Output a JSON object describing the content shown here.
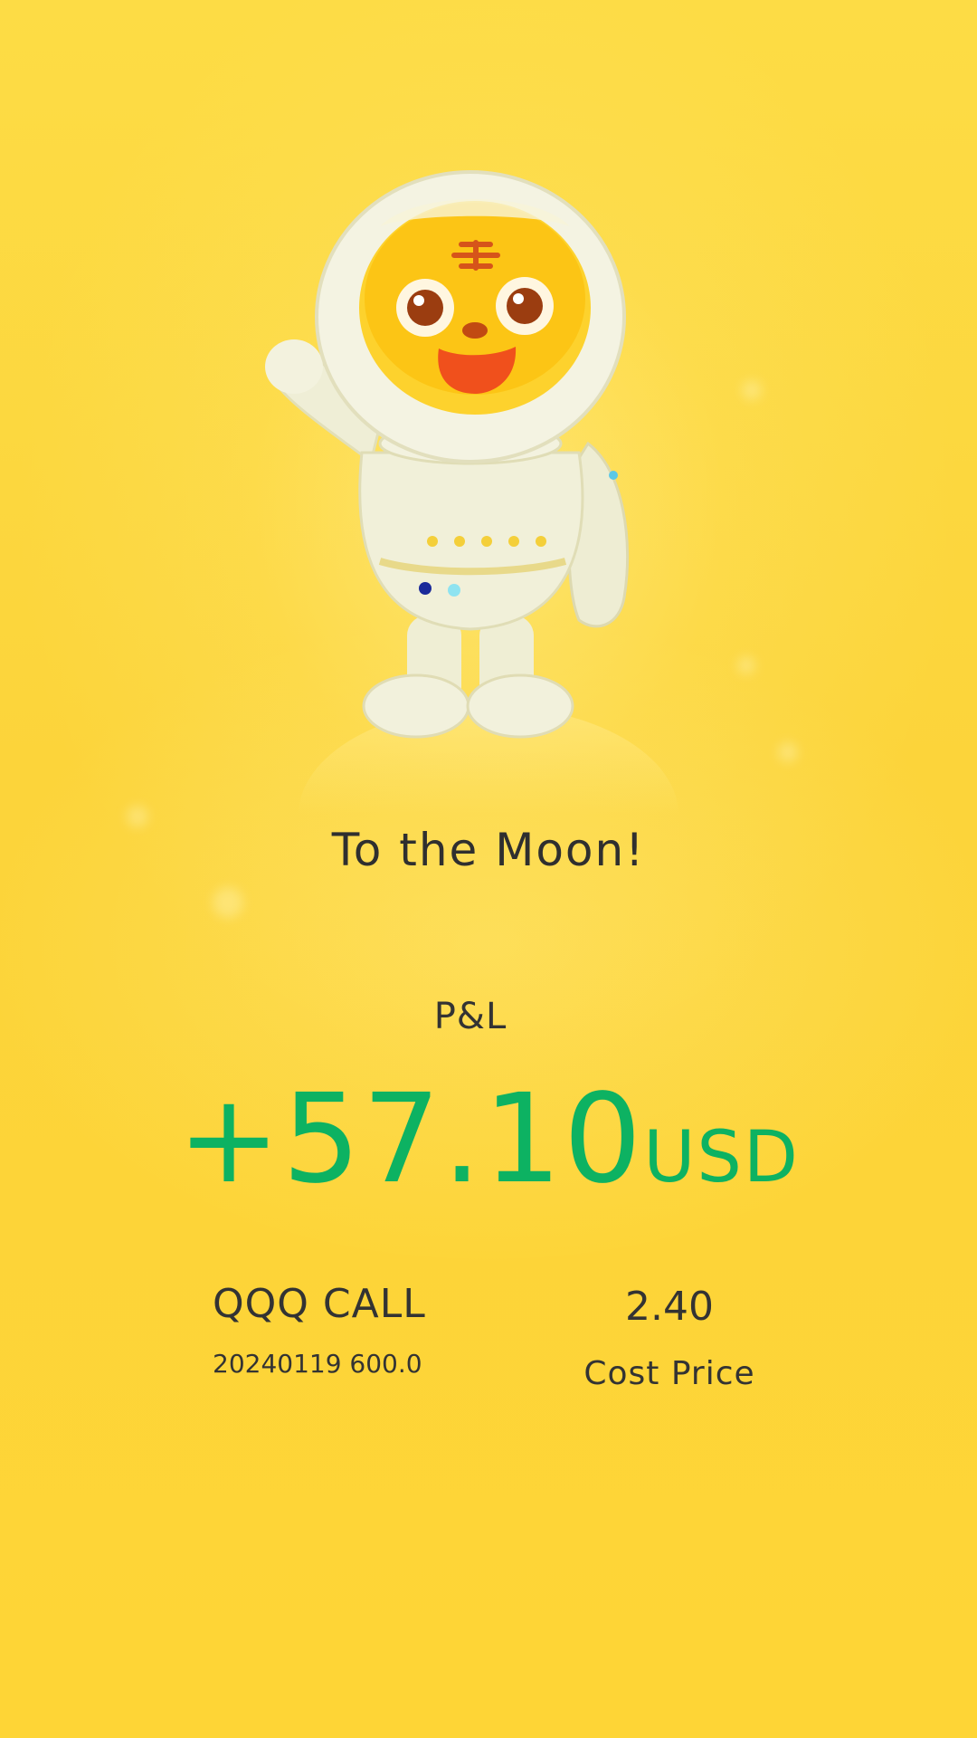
{
  "headline": "To the Moon!",
  "pnl": {
    "label": "P&L",
    "amount": "+57.10",
    "currency": "USD",
    "color": "#0db262"
  },
  "contract": {
    "name": "QQQ CALL",
    "detail": "20240119 600.0"
  },
  "cost": {
    "value": "2.40",
    "label": "Cost Price"
  },
  "illustration": {
    "icon": "astronaut-tiger-mascot",
    "background_color": "#fed63a"
  }
}
